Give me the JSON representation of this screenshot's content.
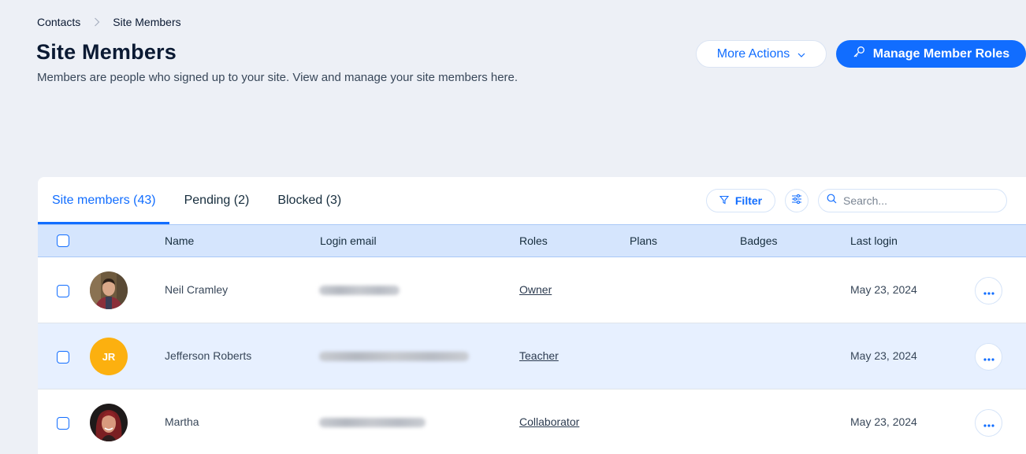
{
  "breadcrumb": {
    "parent": "Contacts",
    "current": "Site Members"
  },
  "header": {
    "title": "Site Members",
    "subtitle": "Members are people who signed up to your site. View and manage your site members here.",
    "more_actions_label": "More Actions",
    "manage_roles_label": "Manage Member Roles"
  },
  "tabs": [
    {
      "label": "Site members (43)",
      "active": true
    },
    {
      "label": "Pending (2)",
      "active": false
    },
    {
      "label": "Blocked (3)",
      "active": false
    }
  ],
  "toolbar": {
    "filter_label": "Filter",
    "search_placeholder": "Search..."
  },
  "table": {
    "columns": [
      "Name",
      "Login email",
      "Roles",
      "Plans",
      "Badges",
      "Last login"
    ],
    "rows": [
      {
        "name": "Neil Cramley",
        "email": "[blurred]",
        "role": "Owner",
        "plans": "",
        "badges": "",
        "last_login": "May 23, 2024",
        "avatar": "photo",
        "highlighted": false
      },
      {
        "name": "Jefferson Roberts",
        "email": "[blurred]",
        "role": "Teacher",
        "plans": "",
        "badges": "",
        "last_login": "May 23, 2024",
        "avatar": "initials",
        "initials": "JR",
        "highlighted": true
      },
      {
        "name": "Martha",
        "email": "[blurred]",
        "role": "Collaborator",
        "plans": "",
        "badges": "",
        "last_login": "May 23, 2024",
        "avatar": "photo",
        "highlighted": false
      }
    ]
  },
  "colors": {
    "accent": "#116dff",
    "page_bg": "#edf0f6",
    "header_row_bg": "#d5e5fd",
    "highlight_row_bg": "#e7f0ff",
    "initials_avatar": "#fcb00f"
  }
}
